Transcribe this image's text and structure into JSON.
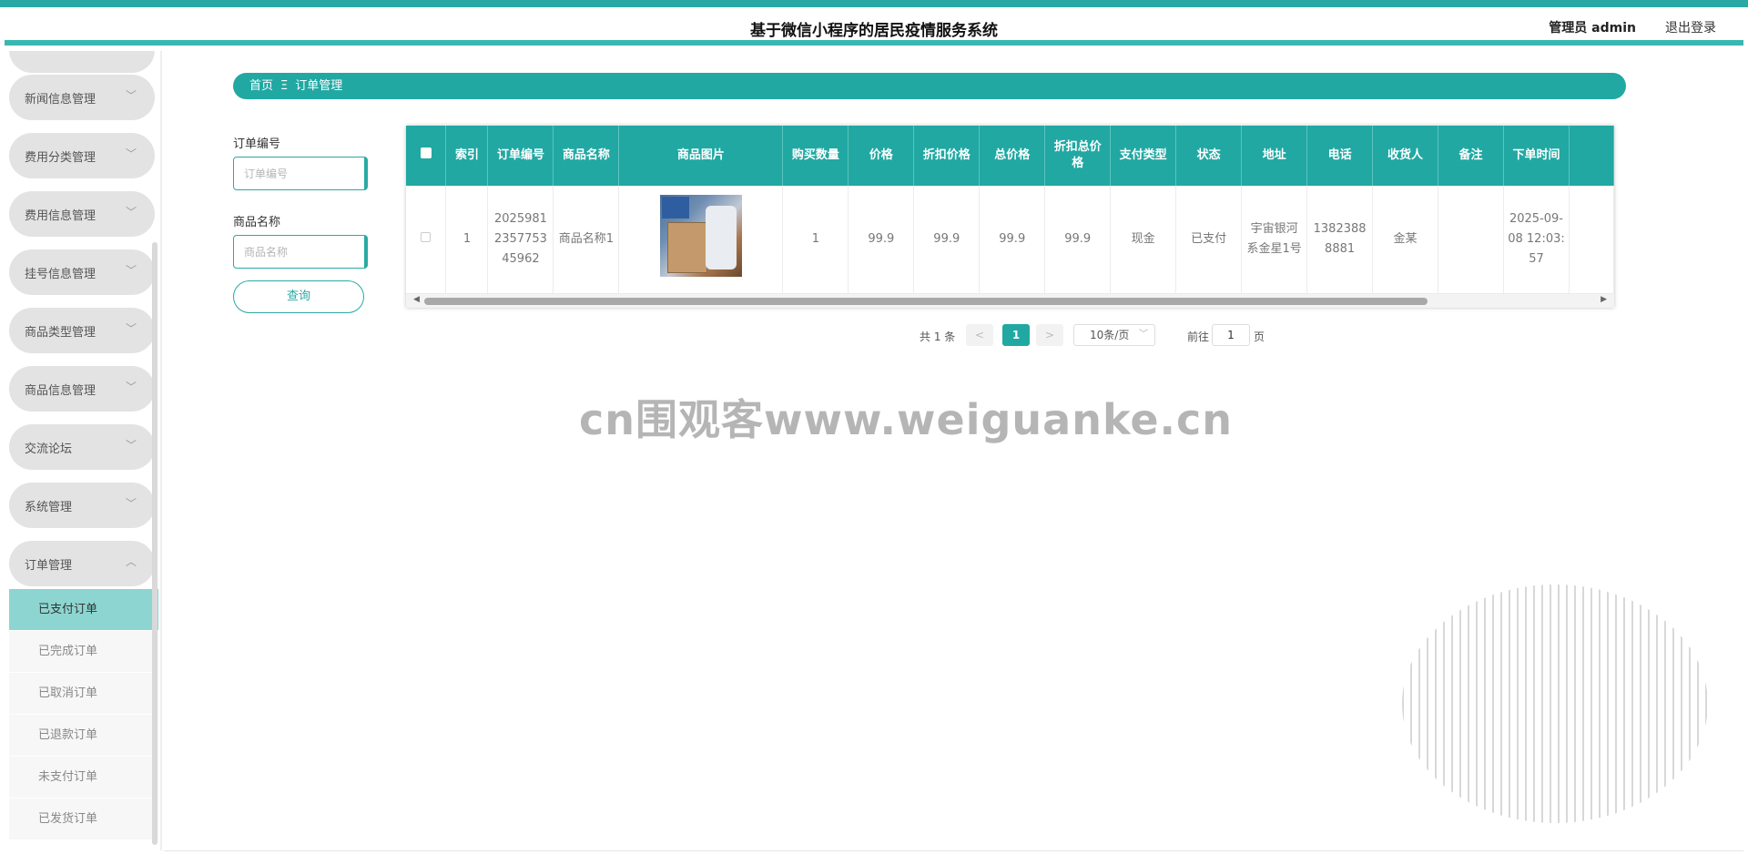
{
  "header": {
    "title": "基于微信小程序的居民疫情服务系统",
    "user": "管理员 admin",
    "logout": "退出登录"
  },
  "sidebar": {
    "menus": [
      {
        "label": "新闻信息管理"
      },
      {
        "label": "费用分类管理"
      },
      {
        "label": "费用信息管理"
      },
      {
        "label": "挂号信息管理"
      },
      {
        "label": "商品类型管理"
      },
      {
        "label": "商品信息管理"
      },
      {
        "label": "交流论坛"
      },
      {
        "label": "系统管理"
      },
      {
        "label": "订单管理"
      }
    ],
    "submenu": [
      {
        "label": "已支付订单"
      },
      {
        "label": "已完成订单"
      },
      {
        "label": "已取消订单"
      },
      {
        "label": "已退款订单"
      },
      {
        "label": "未支付订单"
      },
      {
        "label": "已发货订单"
      }
    ],
    "chev_collapsed": "﹀",
    "chev_expanded": "︿"
  },
  "breadcrumb": {
    "home": "首页",
    "separator": "Ξ",
    "current": "订单管理"
  },
  "filters": {
    "order_no_label": "订单编号",
    "order_no_placeholder": "订单编号",
    "product_name_label": "商品名称",
    "product_name_placeholder": "商品名称",
    "query_button": "查询"
  },
  "table": {
    "headers": [
      "索引",
      "订单编号",
      "商品名称",
      "商品图片",
      "购买数量",
      "价格",
      "折扣价格",
      "总价格",
      "折扣总价格",
      "支付类型",
      "状态",
      "地址",
      "电话",
      "收货人",
      "备注",
      "下单时间"
    ],
    "rows": [
      {
        "index": "1",
        "order_no": "20259812357753 45962",
        "product_name": "商品名称1",
        "image": "product-photo",
        "quantity": "1",
        "price": "99.9",
        "discount_price": "99.9",
        "total_price": "99.9",
        "discount_total": "99.9",
        "pay_type": "现金",
        "status": "已支付",
        "address": "宇宙银河系金星1号",
        "phone": "13823888881",
        "receiver": "金某",
        "remark": "",
        "order_time": "2025-09-08 12:03:57"
      }
    ]
  },
  "pagination": {
    "total": "共 1 条",
    "prev": "<",
    "current": "1",
    "next": ">",
    "page_size": "10条/页",
    "goto_prefix": "前往",
    "goto_value": "1",
    "goto_suffix": "页"
  },
  "watermark": "cn围观客www.weiguanke.cn",
  "colors": {
    "accent": "#21a8a3",
    "active_submenu": "#8dd5d0"
  }
}
